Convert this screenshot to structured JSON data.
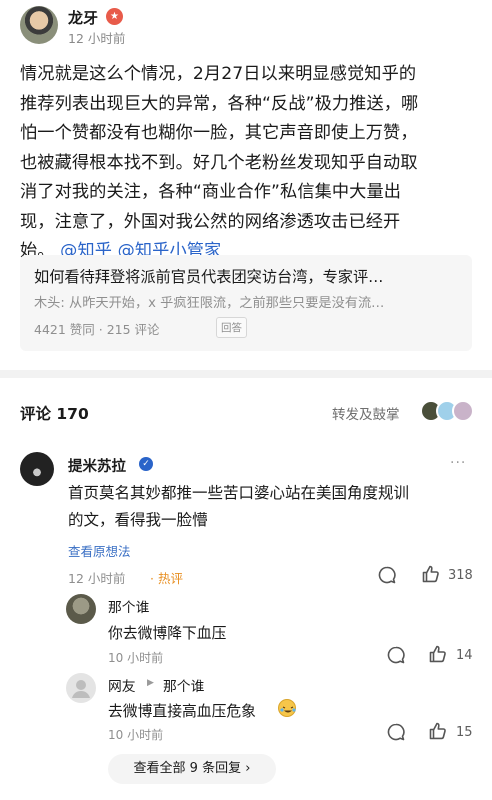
{
  "author": {
    "name": "龙牙",
    "badge_icon": "verified-badge-icon",
    "time": "12 小时前"
  },
  "post": {
    "lines": [
      "情况就是这么个情况，2月27日以来明显感觉知乎的",
      "推荐列表出现巨大的异常，各种“反战”极力推送，哪",
      "怕一个赞都没有也糊你一脸，其它声音即使上万赞，",
      "也被藏得根本找不到。好几个老粉丝发现知乎自动取",
      "消了对我的关注，各种“商业合作”私信集中大量出",
      "现，注意了，外国对我公然的网络渗透攻击已经开"
    ],
    "last_line": "始。",
    "mention_1": "@知乎",
    "mention_2": "@知乎小管家"
  },
  "quote_card": {
    "title": "如何看待拜登将派前官员代表团突访台湾，专家评…",
    "snippet": "木头: 从昨天开始，x 乎疯狂限流，之前那些只要是没有流…",
    "meta": "4421 赞同 · 215 评论",
    "tag": "回答"
  },
  "comments_header": {
    "title": "评论 170",
    "repost_label": "转发及鼓掌"
  },
  "comment": {
    "author": "提米苏拉",
    "text_line_1": "首页莫名其妙都推一些苦口婆心站在美国角度规训",
    "text_line_2": "的文，看得我一脸懵",
    "view_idea": "查看原想法",
    "time": "12 小时前",
    "hot_tag": "· 热评",
    "likes": "318",
    "more": "···"
  },
  "replies": [
    {
      "author": "那个谁",
      "reply_to": "",
      "text": "你去微博降下血压",
      "time": "10 小时前",
      "likes": "14"
    },
    {
      "author": "网友",
      "reply_to": "那个谁",
      "text": "去微博直接高血压危象",
      "emoji_icon": "laughing-tears-emoji-icon",
      "time": "10 小时前",
      "likes": "15"
    }
  ],
  "view_all_replies": "查看全部 9 条回复"
}
